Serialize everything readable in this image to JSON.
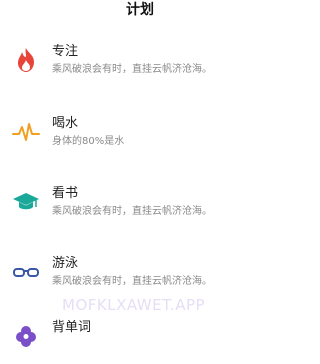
{
  "header": {
    "title": "计划"
  },
  "items": [
    {
      "title": "专注",
      "subtitle": "乘风破浪会有时，直挂云帆济沧海。",
      "icon": "flame-icon",
      "color": "#e8443a"
    },
    {
      "title": "喝水",
      "subtitle": "身体的80%是水",
      "icon": "heartbeat-icon",
      "color": "#f0a020"
    },
    {
      "title": "看书",
      "subtitle": "乘风破浪会有时，直挂云帆济沧海。",
      "icon": "graduation-cap-icon",
      "color": "#1aa899"
    },
    {
      "title": "游泳",
      "subtitle": "乘风破浪会有时，直挂云帆济沧海。",
      "icon": "goggles-icon",
      "color": "#3a57a8"
    },
    {
      "title": "背单词",
      "subtitle": "",
      "icon": "flower-icon",
      "color": "#7a4fc8"
    }
  ],
  "watermark": "MOFKLXAWET.APP"
}
